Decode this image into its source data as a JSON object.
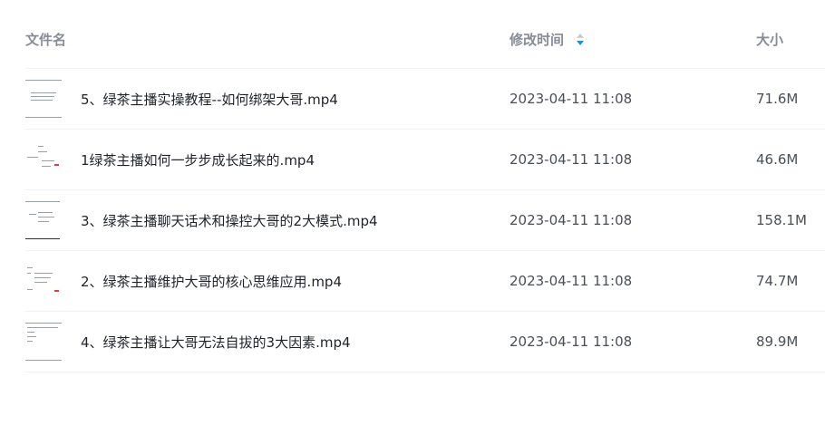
{
  "header": {
    "name_label": "文件名",
    "time_label": "修改时间",
    "size_label": "大小",
    "sort_icon": "sort-icon"
  },
  "files": [
    {
      "name": "5、绿茶主播实操教程--如何绑架大哥.mp4",
      "modified": "2023-04-11 11:08",
      "size": "71.6M"
    },
    {
      "name": "1绿茶主播如何一步步成长起来的.mp4",
      "modified": "2023-04-11 11:08",
      "size": "46.6M"
    },
    {
      "name": "3、绿茶主播聊天话术和操控大哥的2大模式.mp4",
      "modified": "2023-04-11 11:08",
      "size": "158.1M"
    },
    {
      "name": "2、绿茶主播维护大哥的核心思维应用.mp4",
      "modified": "2023-04-11 11:08",
      "size": "74.7M"
    },
    {
      "name": "4、绿茶主播让大哥无法自拔的3大因素.mp4",
      "modified": "2023-04-11 11:08",
      "size": "89.9M"
    }
  ],
  "colors": {
    "sort_active": "#0b99f0",
    "header_text": "#878c96"
  }
}
